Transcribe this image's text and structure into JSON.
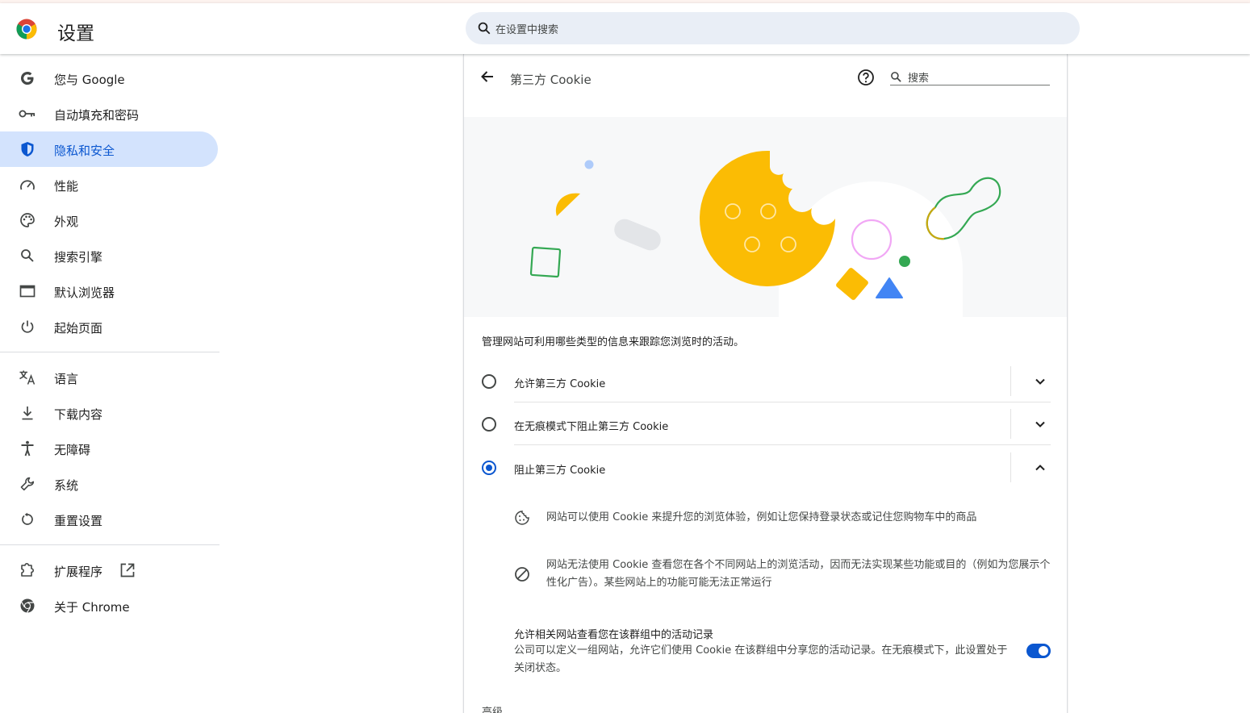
{
  "header": {
    "title": "设置",
    "search_placeholder": "在设置中搜索"
  },
  "sidebar": {
    "items": [
      {
        "label": "您与 Google",
        "icon": "google-g-icon"
      },
      {
        "label": "自动填充和密码",
        "icon": "key-icon"
      },
      {
        "label": "隐私和安全",
        "icon": "shield-icon",
        "active": true
      },
      {
        "label": "性能",
        "icon": "speedometer-icon"
      },
      {
        "label": "外观",
        "icon": "palette-icon"
      },
      {
        "label": "搜索引擎",
        "icon": "search-icon"
      },
      {
        "label": "默认浏览器",
        "icon": "browser-window-icon"
      },
      {
        "label": "起始页面",
        "icon": "power-icon"
      },
      {
        "label": "语言",
        "icon": "translate-icon"
      },
      {
        "label": "下载内容",
        "icon": "download-icon"
      },
      {
        "label": "无障碍",
        "icon": "accessibility-icon"
      },
      {
        "label": "系统",
        "icon": "wrench-icon"
      },
      {
        "label": "重置设置",
        "icon": "reset-icon"
      },
      {
        "label": "扩展程序",
        "icon": "puzzle-icon"
      },
      {
        "label": "关于 Chrome",
        "icon": "chrome-icon"
      }
    ]
  },
  "page": {
    "title": "第三方 Cookie",
    "search_placeholder": "搜索",
    "description": "管理网站可利用哪些类型的信息来跟踪您浏览时的活动。",
    "options": [
      {
        "label": "允许第三方 Cookie",
        "checked": false,
        "expanded": false
      },
      {
        "label": "在无痕模式下阻止第三方 Cookie",
        "checked": false,
        "expanded": false
      },
      {
        "label": "阻止第三方 Cookie",
        "checked": true,
        "expanded": true
      }
    ],
    "details": [
      {
        "icon": "cookie-icon",
        "text": "网站可以使用 Cookie 来提升您的浏览体验，例如让您保持登录状态或记住您购物车中的商品"
      },
      {
        "icon": "block-icon",
        "text": "网站无法使用 Cookie 查看您在各个不同网站上的浏览活动，因而无法实现某些功能或目的（例如为您展示个性化广告）。某些网站上的功能可能无法正常运行"
      }
    ],
    "related_sites": {
      "title": "允许相关网站查看您在该群组中的活动记录",
      "description": "公司可以定义一组网站，允许它们使用 Cookie 在该群组中分享您的活动记录。在无痕模式下，此设置处于关闭状态。",
      "enabled": true
    },
    "advanced_label": "高级"
  },
  "colors": {
    "accent": "#0b57d0",
    "active_bg": "#d3e3fd",
    "cookie_yellow": "#fbbc04"
  }
}
